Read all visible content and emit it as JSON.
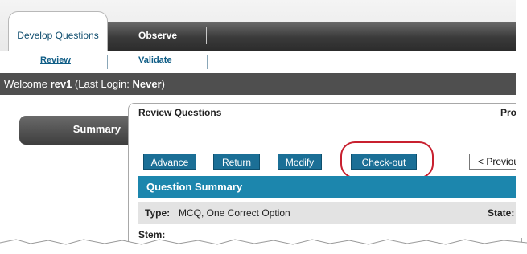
{
  "tabs": {
    "develop_questions": "Develop Questions",
    "observe": "Observe"
  },
  "subnav": {
    "review": "Review",
    "validate": "Validate"
  },
  "welcome": {
    "prefix": "Welcome ",
    "user": "rev1",
    "mid": " (Last Login: ",
    "last_login": "Never",
    "suffix": ")"
  },
  "sidebar": {
    "summary": "Summary"
  },
  "panel": {
    "title": "Review Questions",
    "right_fragment": "Pro"
  },
  "buttons": {
    "advance": "Advance",
    "return": "Return",
    "modify": "Modify",
    "checkout": "Check-out",
    "previous": "< Previous"
  },
  "question_summary": {
    "header": "Question Summary",
    "type_label": "Type:",
    "type_value": "MCQ, One Correct Option",
    "state_label": "State:",
    "stem_label": "Stem:"
  },
  "colors": {
    "accent": "#1b6f96",
    "header_bar": "#1c86ad",
    "highlight": "#c8202f"
  }
}
